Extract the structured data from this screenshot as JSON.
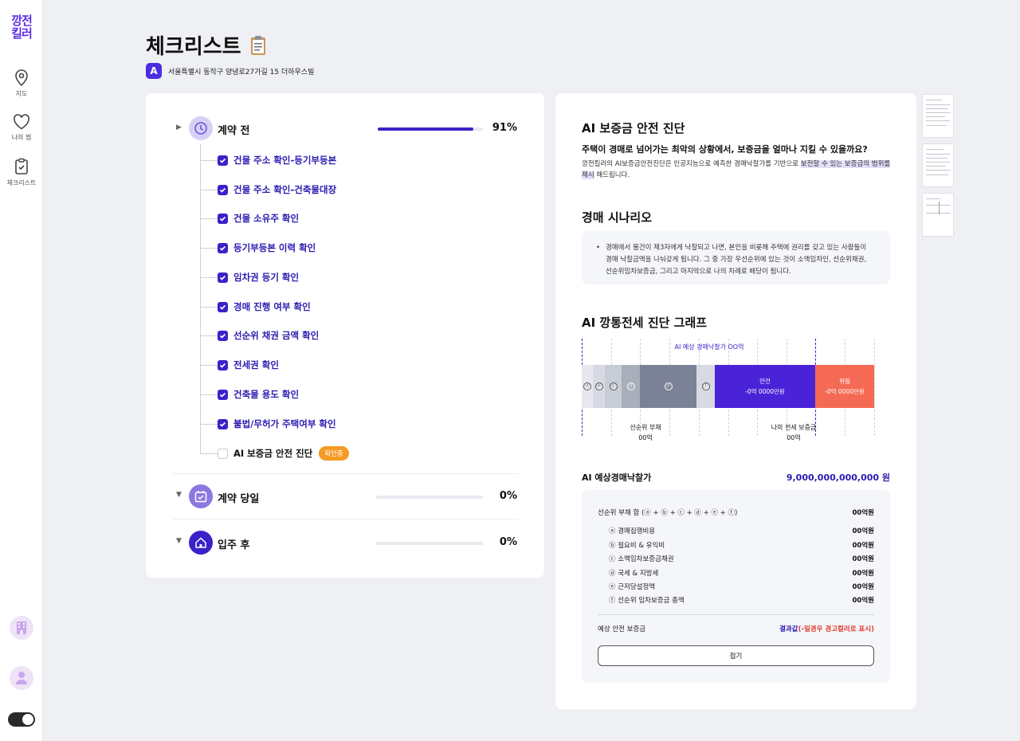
{
  "logo": {
    "line1": "깡전",
    "line2": "킬러"
  },
  "nav": [
    {
      "label": "지도",
      "icon": "map-pin-icon"
    },
    {
      "label": "나의 찜",
      "icon": "heart-icon"
    },
    {
      "label": "체크리스트",
      "icon": "clipboard-icon"
    }
  ],
  "header": {
    "title": "체크리스트",
    "title_icon": "clipboard-emoji-icon",
    "address_badge": "A",
    "address": "서울특별시 동작구 양녕로27가길 15 더하우스빌"
  },
  "sections": [
    {
      "title": "계약 전",
      "percent_text": "91%",
      "progress": 0.91,
      "expanded": true,
      "icon": "clock-icon"
    },
    {
      "title": "계약 당일",
      "percent_text": "0%",
      "progress": 0,
      "expanded": false,
      "icon": "calendar-check-icon"
    },
    {
      "title": "입주 후",
      "percent_text": "0%",
      "progress": 0,
      "expanded": false,
      "icon": "home-icon"
    }
  ],
  "checklist": [
    {
      "label": "건물 주소 확인-등기부등본",
      "checked": true
    },
    {
      "label": "건물 주소 확인-건축물대장",
      "checked": true
    },
    {
      "label": "건물 소유주 확인",
      "checked": true
    },
    {
      "label": "등기부등본 이력 확인",
      "checked": true
    },
    {
      "label": "임차권 등기 확인",
      "checked": true
    },
    {
      "label": "경매 진행 여부 확인",
      "checked": true
    },
    {
      "label": "선순위 채권 금액 확인",
      "checked": true
    },
    {
      "label": "전세권 확인",
      "checked": true
    },
    {
      "label": "건축물 용도 확인",
      "checked": true
    },
    {
      "label": "불법/무허가 주택여부 확인",
      "checked": true
    },
    {
      "label": "AI 보증금 안전 진단",
      "checked": false,
      "badge": "확인중"
    }
  ],
  "diagnosis": {
    "title": "AI 보증금 안전 진단",
    "question": "주택이 경매로 넘어가는 최악의 상황에서, 보증금을 얼마나 지킬 수 있을까요?",
    "desc_before": "깡전킬러의 AI보증금안전진단은 인공지능으로 예측한 경매낙찰가를 기반으로 ",
    "desc_highlight": "보전할 수 있는 보증금의 범위를 제시",
    "desc_after": " 해드립니다."
  },
  "scenario": {
    "title": "경매 시나리오",
    "text": "경매에서 물건이 제3자에게 낙찰되고 나면, 본인을 비롯해 주택에 권리를 갖고 있는 사람들이 경매 낙찰금액을 나눠갖게 됩니다. 그 중 가장 우선순위에 있는 것이 소액임차인, 선순위채권, 선순위임차보증금, 그리고 마지막으로 나의 차례로 배당이 됩니다."
  },
  "graph": {
    "title": "AI 깡통전세 진단 그래프",
    "predicted_label": "AI 예상 경매낙찰가 OO억",
    "segments": [
      "ⓐ",
      "ⓑ",
      "ⓒ",
      "ⓓ",
      "ⓔ",
      "ⓕ"
    ],
    "safe_label": "안전",
    "safe_value": "-0억 0000만원",
    "danger_label": "위험",
    "danger_value": "-0억 0000만원",
    "senior_debt_label": "선순위 부채",
    "senior_debt_value": "00억",
    "my_deposit_label": "나의 전세 보증금",
    "my_deposit_value": "00억",
    "colors": {
      "safe": "#4a22d8",
      "danger": "#f56a55",
      "mid": "#7b8297"
    }
  },
  "bid": {
    "label": "AI 예상경매낙찰가",
    "value": "9,000,000,000,000 원"
  },
  "breakdown": {
    "total_label": "선순위 부채 합 (ⓐ + ⓑ + ⓒ + ⓓ + ⓔ + ⓕ)",
    "total_value": "00억원",
    "items": [
      {
        "label": "ⓐ 경매집행비용",
        "value": "00억원"
      },
      {
        "label": "ⓑ 필요비 & 유익비",
        "value": "00억원"
      },
      {
        "label": "ⓒ 소액임차보증금채권",
        "value": "00억원"
      },
      {
        "label": "ⓓ 국세 & 지방세",
        "value": "00억원"
      },
      {
        "label": "ⓔ 근저당설정액",
        "value": "00억원"
      },
      {
        "label": "ⓕ 선순위 임차보증금 총액",
        "value": "00억원"
      }
    ],
    "safe_deposit_label": "예상 안전 보증금",
    "result_value": "결과값",
    "result_note": "(-일경우 경고컬러로 표시)",
    "fold_label": "접기"
  },
  "theme": {
    "accent": "#3a22c9",
    "warning": "#f59a23",
    "danger": "#e03a2f"
  }
}
